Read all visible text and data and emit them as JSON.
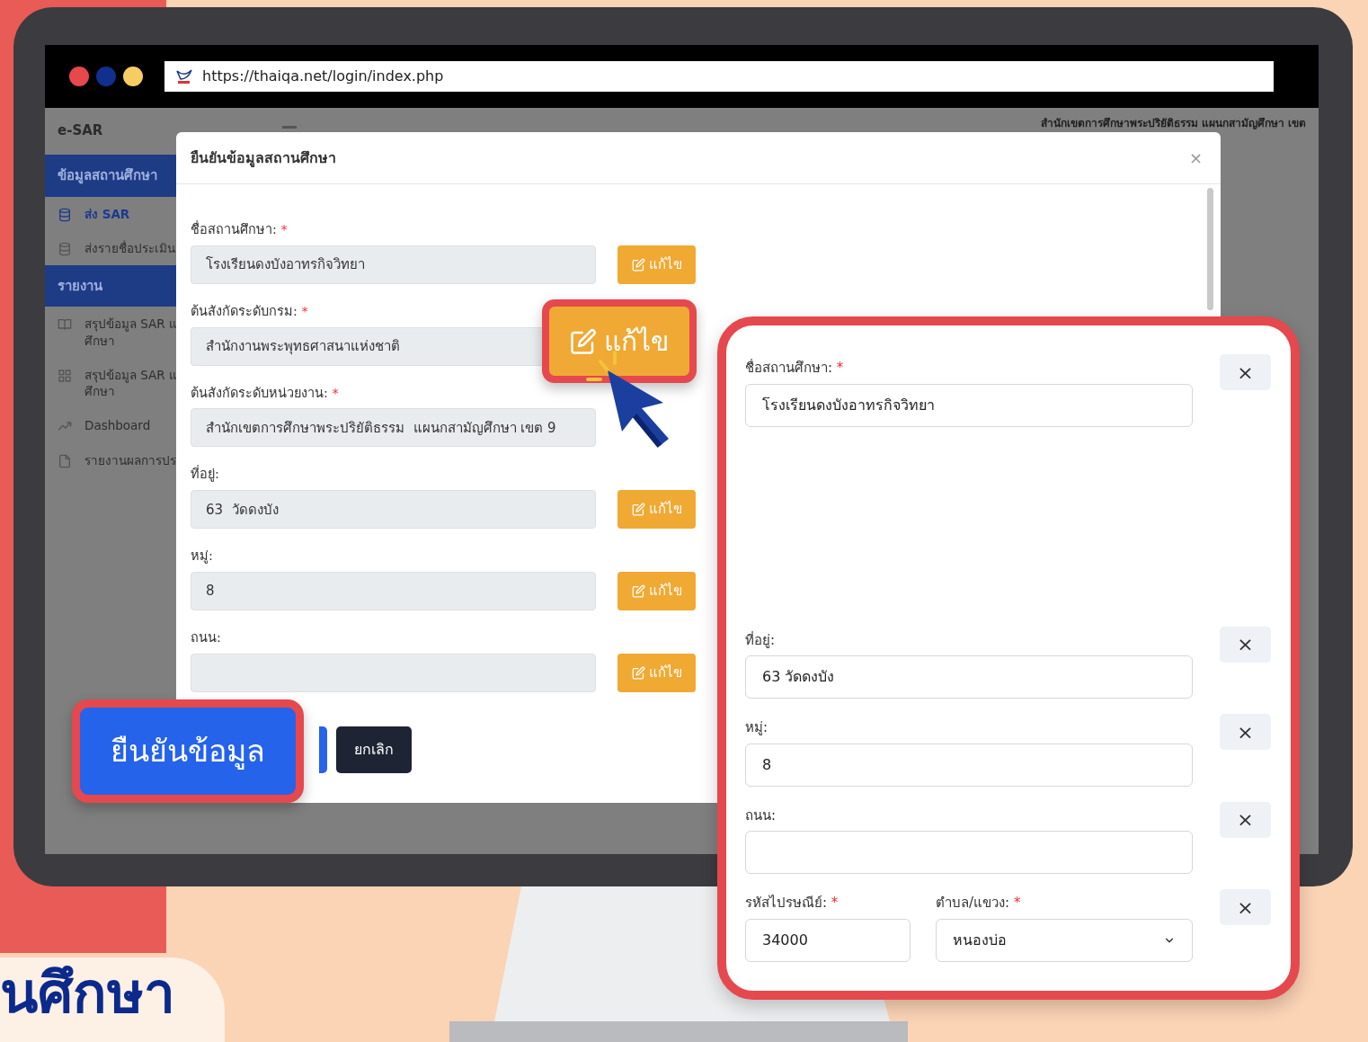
{
  "browser": {
    "dots": [
      {
        "color": "#e8484b"
      },
      {
        "color": "#112f8f"
      },
      {
        "color": "#f6cd63"
      }
    ],
    "url": "https://thaiqa.net/login/index.php"
  },
  "app": {
    "brand": "e-SAR",
    "header_text": "สำนักเขตการศึกษาพระปริยัติธรรม แผนกสามัญศึกษา เขต",
    "sidebar": [
      {
        "kind": "section",
        "label": "ข้อมูลสถานศึกษา"
      },
      {
        "kind": "item",
        "lines": [
          "ส่ง SAR"
        ],
        "selected": true
      },
      {
        "kind": "item",
        "lines": [
          "ส่งรายชื่อประเมิน"
        ],
        "selected": false
      },
      {
        "kind": "section",
        "label": "รายงาน"
      },
      {
        "kind": "item",
        "lines": [
          "สรุปข้อมูล SAR แ",
          "ศึกษา"
        ],
        "selected": false
      },
      {
        "kind": "item",
        "lines": [
          "สรุปข้อมูล SAR แ",
          "ศึกษา"
        ],
        "selected": false
      },
      {
        "kind": "item",
        "lines": [
          "Dashboard"
        ],
        "selected": false
      },
      {
        "kind": "item",
        "lines": [
          "รายงานผลการปร"
        ],
        "selected": false
      }
    ]
  },
  "modal": {
    "title": "ยืนยันข้อมูลสถานศึกษา",
    "close": "×",
    "fields": [
      {
        "label": "ชื่อสถานศึกษา:",
        "required_mark": "*",
        "value": "โรงเรียนดงบังอาทรกิจวิทยา",
        "edit": "แก้ไข"
      },
      {
        "label": "ต้นสังกัดระดับกรม:",
        "required_mark": "*",
        "value": "สำนักงานพระพุทธศาสนาแห่งชาติ"
      },
      {
        "label": "ต้นสังกัดระดับหน่วยงาน:",
        "required_mark": "*",
        "value": "สำนักเขตการศึกษาพระปริยัติธรรม  แผนกสามัญศึกษา เขต 9"
      },
      {
        "label": "ที่อยู่:",
        "value": "63  วัดดงบัง",
        "edit": "แก้ไข"
      },
      {
        "label": "หมู่:",
        "value": "8",
        "edit": "แก้ไข"
      },
      {
        "label": "ถนน:",
        "edit": "แก้ไข"
      }
    ],
    "cancel": "ยกเลิก"
  },
  "callouts": {
    "edit_button": "แก้ไข",
    "confirm_button": "ยืนยันข้อมูล",
    "panel_rows": [
      {
        "remove": "×",
        "fields": [
          {
            "label": "ชื่อสถานศึกษา:",
            "required_mark": "*",
            "value": "โรงเรียนดงบังอาทรกิจวิทยา",
            "kind": "text"
          }
        ]
      },
      {
        "remove": "×",
        "fields": [
          {
            "label": "ที่อยู่:",
            "value": "63  วัดดงบัง",
            "kind": "text"
          }
        ]
      },
      {
        "remove": "×",
        "fields": [
          {
            "label": "หมู่:",
            "value": "8",
            "kind": "text"
          }
        ]
      },
      {
        "remove": "×",
        "fields": [
          {
            "label": "ถนน:",
            "kind": "text"
          }
        ]
      },
      {
        "remove": "×",
        "fields": [
          {
            "label": "รหัสไปรษณีย์:",
            "required_mark": "*",
            "value": "34000",
            "kind": "text"
          },
          {
            "label": "ตำบล/แขวง:",
            "required_mark": "*",
            "value": "หนองบ่อ",
            "kind": "select"
          }
        ]
      }
    ]
  },
  "banner_title": "นศึกษา"
}
